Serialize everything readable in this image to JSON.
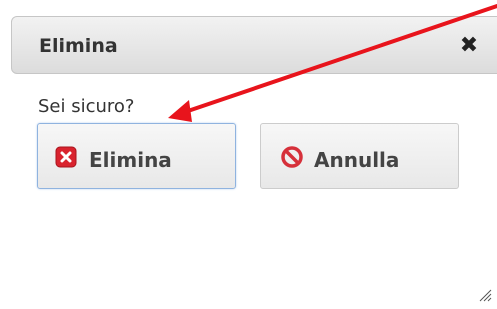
{
  "dialog": {
    "title": "Elimina",
    "close_icon": "close-icon",
    "message": "Sei sicuro?",
    "buttons": {
      "delete_label": "Elimina",
      "delete_icon": "delete-icon",
      "cancel_label": "Annulla",
      "cancel_icon": "cancel-icon"
    }
  },
  "colors": {
    "annotation_arrow": "#e8141c",
    "delete_icon": "#d9232e",
    "cancel_icon": "#d6303a",
    "focus_border": "#8fb3df"
  }
}
